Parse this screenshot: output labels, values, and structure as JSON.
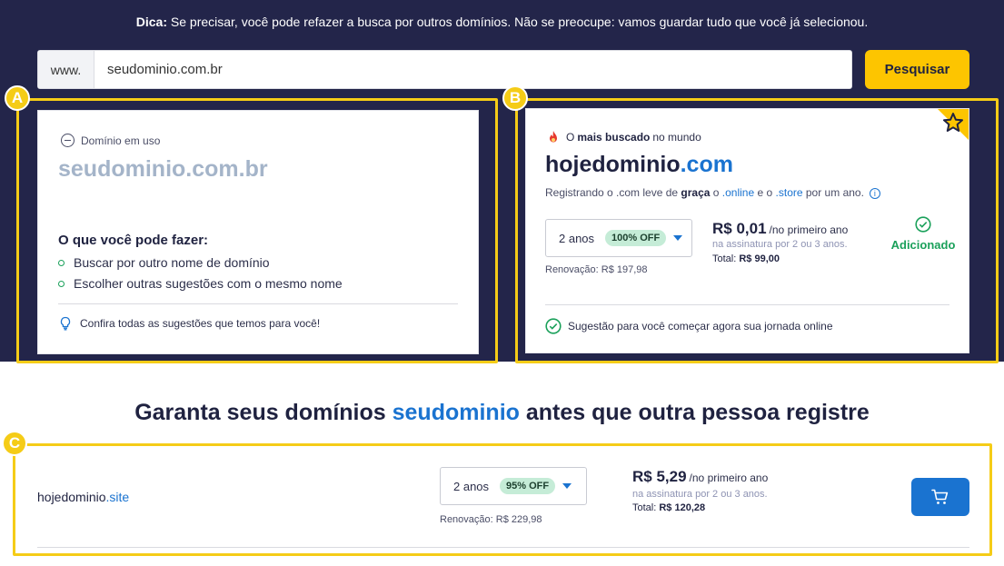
{
  "tip": {
    "bold": "Dica:",
    "text": " Se precisar, você pode refazer a busca por outros domínios. Não se preocupe: vamos guardar tudo que você já selecionou."
  },
  "search": {
    "prefix": "www.",
    "value": "seudominio.com.br",
    "button": "Pesquisar"
  },
  "badges": {
    "a": "A",
    "b": "B",
    "c": "C"
  },
  "cardA": {
    "status": "Domínio em uso",
    "domain": "seudominio.com.br",
    "heading": "O que você pode fazer:",
    "options": [
      "Buscar por outro nome de domínio",
      "Escolher outras sugestões com o mesmo nome"
    ],
    "footer": "Confira todas as sugestões que temos para você!"
  },
  "cardB": {
    "tag_pre": "O",
    "tag_bold": "mais buscado",
    "tag_post": "no mundo",
    "domain_name": "hojedominio",
    "domain_tld": ".com",
    "reg_1": "Registrando o .com leve de ",
    "reg_bold": "graça",
    "reg_2": " o ",
    "reg_online": ".online",
    "reg_3": " e o ",
    "reg_store": ".store",
    "reg_4": " por um ano.",
    "period": "2 anos",
    "discount": "100% OFF",
    "renewal": "Renovação: R$ 197,98",
    "price": "R$ 0,01",
    "price_suffix": "/no primeiro ano",
    "subscription": "na assinatura por 2 ou 3 anos.",
    "total_label": "Total: ",
    "total_value": "R$ 99,00",
    "added": "Adicionado",
    "suggestion": "Sugestão para você começar agora sua jornada online"
  },
  "headline": {
    "pre": "Garanta seus domínios ",
    "highlight": "seudominio",
    "post": " antes que outra pessoa registre"
  },
  "rowC": {
    "domain_name": "hojedominio",
    "domain_tld": ".site",
    "period": "2 anos",
    "discount": "95% OFF",
    "renewal": "Renovação: R$ 229,98",
    "price": "R$ 5,29",
    "price_suffix": "/no primeiro ano",
    "subscription": "na assinatura por 2 ou 3 anos.",
    "total_label": "Total: ",
    "total_value": "R$ 120,28"
  },
  "colors": {
    "navy": "#23254a",
    "yellow": "#fdc500",
    "highlight": "#f5cc17",
    "blue": "#1a73d0",
    "green": "#1aa05a"
  },
  "icons": [
    "minus-circle-icon",
    "lightbulb-icon",
    "fire-icon",
    "info-icon",
    "check-circle-icon",
    "star-icon",
    "cart-icon",
    "chevron-down-icon"
  ]
}
